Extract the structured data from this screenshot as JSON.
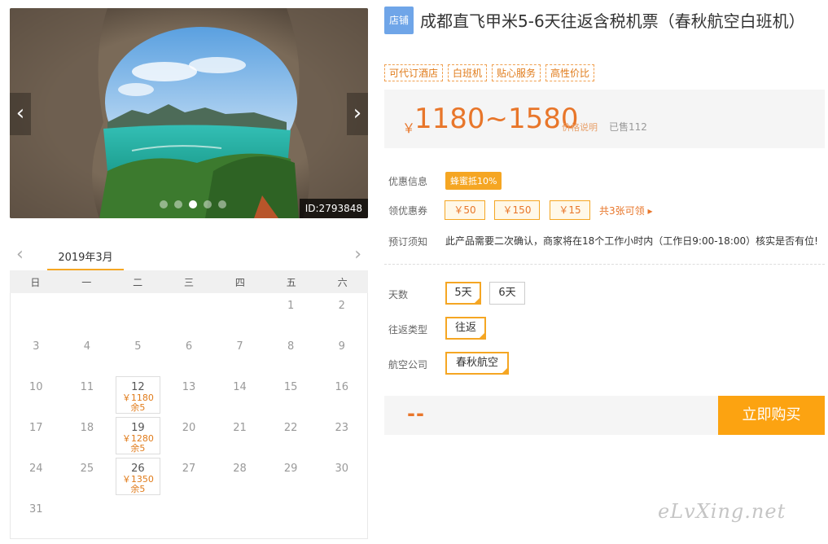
{
  "gallery": {
    "prev_icon": "‹",
    "next_icon": "›",
    "dot_count": 5,
    "active_dot": 2,
    "id_badge": "ID:2793848"
  },
  "calendar": {
    "month": "2019年3月",
    "prev_icon": "‹",
    "next_icon": "›",
    "weekdays": [
      "日",
      "一",
      "二",
      "三",
      "四",
      "五",
      "六"
    ],
    "days": [
      {
        "day": ""
      },
      {
        "day": ""
      },
      {
        "day": ""
      },
      {
        "day": ""
      },
      {
        "day": ""
      },
      {
        "day": "1"
      },
      {
        "day": "2"
      },
      {
        "day": "3"
      },
      {
        "day": "4"
      },
      {
        "day": "5"
      },
      {
        "day": "6"
      },
      {
        "day": "7"
      },
      {
        "day": "8"
      },
      {
        "day": "9"
      },
      {
        "day": "10"
      },
      {
        "day": "11"
      },
      {
        "day": "12",
        "price": "￥1180",
        "left": "余5"
      },
      {
        "day": "13"
      },
      {
        "day": "14"
      },
      {
        "day": "15"
      },
      {
        "day": "16"
      },
      {
        "day": "17"
      },
      {
        "day": "18"
      },
      {
        "day": "19",
        "price": "￥1280",
        "left": "余5"
      },
      {
        "day": "20"
      },
      {
        "day": "21"
      },
      {
        "day": "22"
      },
      {
        "day": "23"
      },
      {
        "day": "24"
      },
      {
        "day": "25"
      },
      {
        "day": "26",
        "price": "￥1350",
        "left": "余5"
      },
      {
        "day": "27"
      },
      {
        "day": "28"
      },
      {
        "day": "29"
      },
      {
        "day": "30"
      },
      {
        "day": "31"
      }
    ]
  },
  "product": {
    "shop_tag": "店铺",
    "title": "成都直飞甲米5-6天往返含税机票（春秋航空白班机）",
    "tags": [
      "可代订酒店",
      "白班机",
      "贴心服务",
      "高性价比"
    ]
  },
  "price": {
    "currency": "￥",
    "range": "1180~1580",
    "note": "价格说明",
    "sold": "已售112"
  },
  "promo": {
    "label": "优惠信息",
    "badge": "蜂蜜抵10%"
  },
  "coupons": {
    "label": "领优惠券",
    "items": [
      "￥50",
      "￥150",
      "￥15"
    ],
    "total": "共3张可领 ▸"
  },
  "notice": {
    "label": "预订须知",
    "text": "此产品需要二次确认，商家将在18个工作小时内（工作日9:00-18:00）核实是否有位!"
  },
  "options": {
    "days_label": "天数",
    "days": [
      "5天",
      "6天"
    ],
    "trip_label": "往返类型",
    "trip": [
      "往返"
    ],
    "airline_label": "航空公司",
    "airline": [
      "春秋航空"
    ]
  },
  "purchase": {
    "total": "--",
    "buy_label": "立即购买"
  },
  "watermark": "eLvXing.net",
  "colors": {
    "accent": "#f5a623",
    "price": "#e8762a",
    "buy_button": "#fca311",
    "shop_tag": "#6fa5e8"
  }
}
